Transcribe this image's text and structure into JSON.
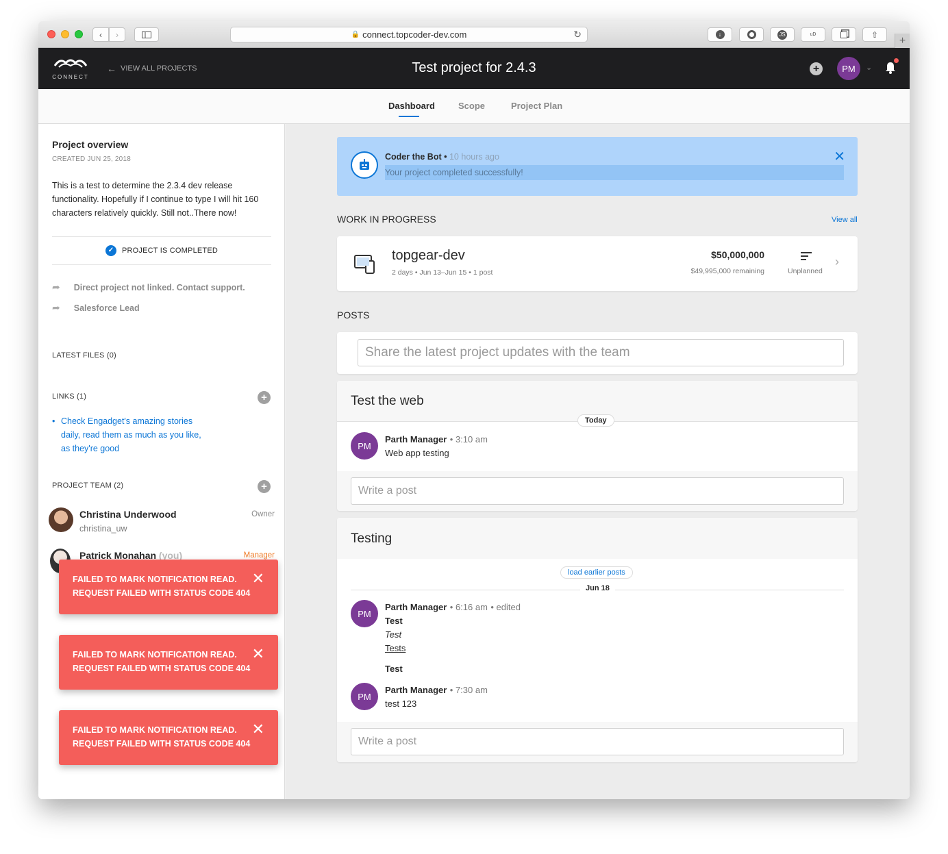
{
  "browser": {
    "url": "connect.topcoder-dev.com"
  },
  "topbar": {
    "logo_text": "CONNECT",
    "back_label": "VIEW ALL PROJECTS",
    "title": "Test project for 2.4.3",
    "avatar_initials": "PM"
  },
  "tabs": [
    {
      "label": "Dashboard"
    },
    {
      "label": "Scope"
    },
    {
      "label": "Project Plan"
    }
  ],
  "sidebar": {
    "overview_title": "Project overview",
    "created": "CREATED JUN 25, 2018",
    "description": "This is a test to determine the 2.3.4 dev release functionality. Hopefully if I continue to type I will hit 160 characters relatively quickly. Still not..There now!",
    "status": "PROJECT IS COMPLETED",
    "links_info": [
      {
        "label": "Direct project not linked. Contact support."
      },
      {
        "label": "Salesforce Lead"
      }
    ],
    "latest_files": "LATEST FILES (0)",
    "links_title": "LINKS (1)",
    "link_items": [
      {
        "label": "Check Engadget's amazing stories daily, read them as much as you like, as they're good"
      }
    ],
    "team_title": "PROJECT TEAM (2)",
    "team": [
      {
        "name": "Christina Underwood",
        "handle": "christina_uw",
        "role": "Owner"
      },
      {
        "name": "Patrick Monahan",
        "you": "(you)",
        "role": "Manager"
      }
    ]
  },
  "toasts": [
    {
      "line1": "FAILED TO MARK NOTIFICATION READ.",
      "line2": "REQUEST FAILED WITH STATUS CODE 404"
    },
    {
      "line1": "FAILED TO MARK NOTIFICATION READ.",
      "line2": "REQUEST FAILED WITH STATUS CODE 404"
    },
    {
      "line1": "FAILED TO MARK NOTIFICATION READ.",
      "line2": "REQUEST FAILED WITH STATUS CODE 404"
    }
  ],
  "banner": {
    "author": "Coder the Bot",
    "time": "10 hours ago",
    "message": "Your project completed successfully!"
  },
  "wip": {
    "title": "WORK IN PROGRESS",
    "view_all": "View all",
    "item": {
      "name": "topgear-dev",
      "meta": "2 days • Jun 13–Jun 15 • 1 post",
      "amount": "$50,000,000",
      "remaining": "$49,995,000 remaining",
      "status": "Unplanned"
    }
  },
  "posts": {
    "title": "POSTS",
    "new_post_placeholder": "Share the latest project updates with the team",
    "threads": [
      {
        "title": "Test the web",
        "divider": "Today",
        "entries": [
          {
            "initials": "PM",
            "author": "Parth Manager",
            "time": "3:10 am",
            "body": "Web app testing"
          }
        ],
        "reply_placeholder": "Write a post"
      },
      {
        "title": "Testing",
        "load_earlier": "load earlier posts",
        "divider": "Jun 18",
        "entries": [
          {
            "initials": "PM",
            "author": "Parth Manager",
            "time": "6:16 am",
            "edited": "edited",
            "bold": "Test",
            "italic": "Test",
            "underline": "Tests",
            "bold2": "Test"
          },
          {
            "initials": "PM",
            "author": "Parth Manager",
            "time": "7:30 am",
            "body": "test 123"
          }
        ],
        "reply_placeholder": "Write a post"
      }
    ]
  },
  "colors": {
    "topbar": "#1e1e20",
    "accent_blue": "#0c76d6",
    "banner_bg": "#afd4fb",
    "toast_red": "#f45e5a",
    "avatar_purple": "#7b3a96",
    "manager_orange": "#ef7d29"
  }
}
